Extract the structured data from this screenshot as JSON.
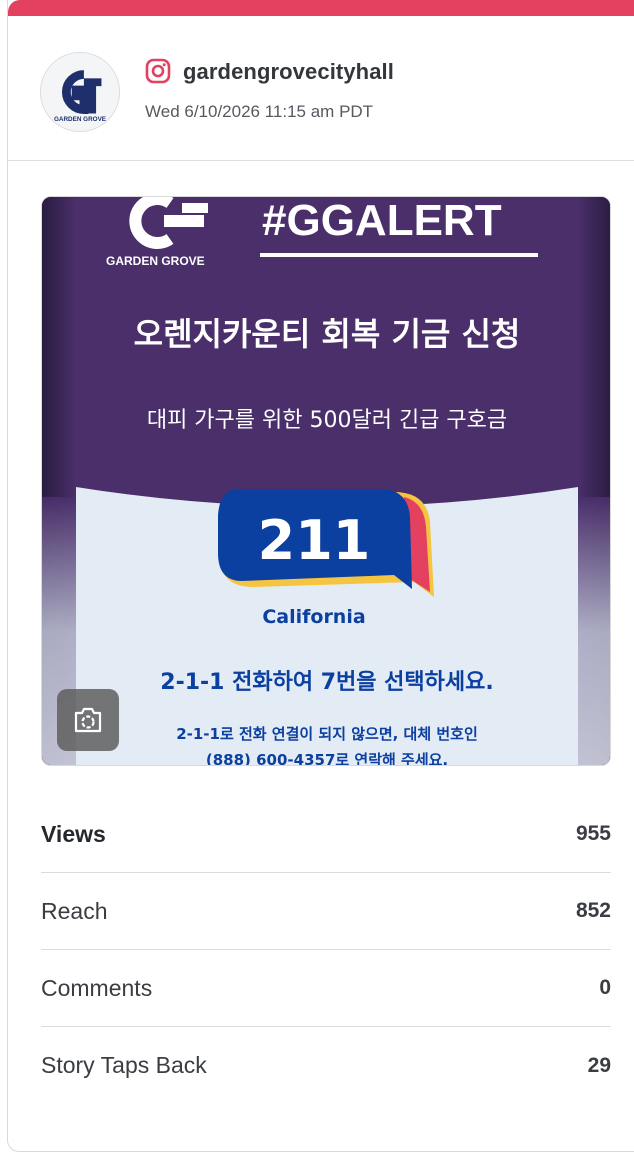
{
  "post": {
    "account_name": "gardengrovecityhall",
    "platform_icon": "instagram-icon",
    "date": "Wed 6/10/2026 11:15 am PDT",
    "avatar_text": "GARDEN GROVE"
  },
  "image": {
    "brand_text": "GARDEN GROVE",
    "hashtag": "#GGALERT",
    "headline": "오렌지카운티 회복 기금 신청",
    "subheadline": "대피 가구를 위한 500달러 긴급 구호금",
    "badge_number": "211",
    "badge_region": "California",
    "instruction": "2-1-1 전화하여 7번을 선택하세요.",
    "fallback_line1": "2-1-1로 전화 연결이 되지 않으면, 대체 번호인",
    "fallback_line2": "(888) 600-4357로 연락해 주세요.",
    "camera_icon": "camera-icon"
  },
  "metrics": [
    {
      "label": "Views",
      "value": "955"
    },
    {
      "label": "Reach",
      "value": "852"
    },
    {
      "label": "Comments",
      "value": "0"
    },
    {
      "label": "Story Taps Back",
      "value": "29"
    }
  ],
  "colors": {
    "accent": "#e4405f",
    "purple": "#4a2f6b",
    "blue": "#0b3fa0",
    "yellow": "#f5c542",
    "light_blue_bg": "#e3ebf5"
  }
}
